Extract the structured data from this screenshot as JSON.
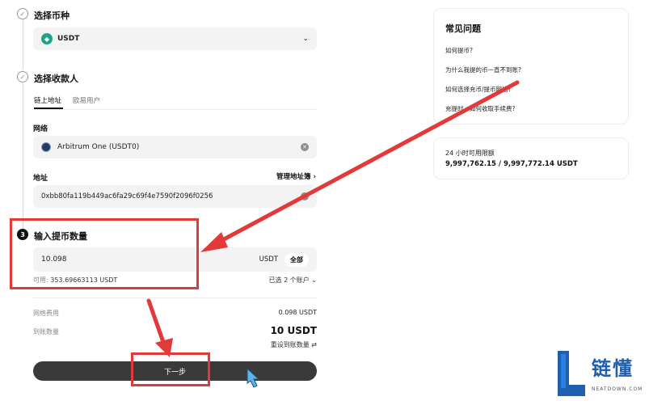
{
  "steps": {
    "step1_title": "选择币种",
    "step2_title": "选择收款人",
    "step3_number": "3",
    "step3_title": "输入提币数量"
  },
  "coin": {
    "name": "USDT"
  },
  "recipient_tabs": {
    "onchain": "链上地址",
    "exchange": "欧易用户"
  },
  "network": {
    "label": "网络",
    "value": "Arbitrum One (USDT0)"
  },
  "address": {
    "label": "地址",
    "manage_link": "管理地址簿",
    "value": "0xbb80fa119b449ac6fa29c69f4e7590f2096f0256"
  },
  "amount": {
    "value": "10.098",
    "unit": "USDT",
    "max_button": "全部",
    "available_label": "可用:",
    "available_value": "353.69663113 USDT",
    "accounts_selected": "已选 2 个账户"
  },
  "summary": {
    "fee_label": "网络费用",
    "fee_value": "0.098 USDT",
    "receive_label": "到账数量",
    "receive_value": "10 USDT",
    "reset_link": "重设到账数量"
  },
  "next_button": "下一步",
  "faq": {
    "title": "常见问题",
    "items": [
      "如何提币?",
      "为什么我提的币一直不到账?",
      "如何选择充币/提币网络?",
      "充提时，如何收取手续费?"
    ]
  },
  "limits": {
    "title": "24 小时可用限额",
    "value": "9,997,762.15 / 9,997,772.14 USDT"
  },
  "watermark": {
    "brand": "链懂",
    "domain": "NEATDOWN.COM"
  },
  "colors": {
    "annotation_red": "#e23a3a",
    "coin_teal": "#1ea38a",
    "dark_button": "#3a3a3a"
  }
}
